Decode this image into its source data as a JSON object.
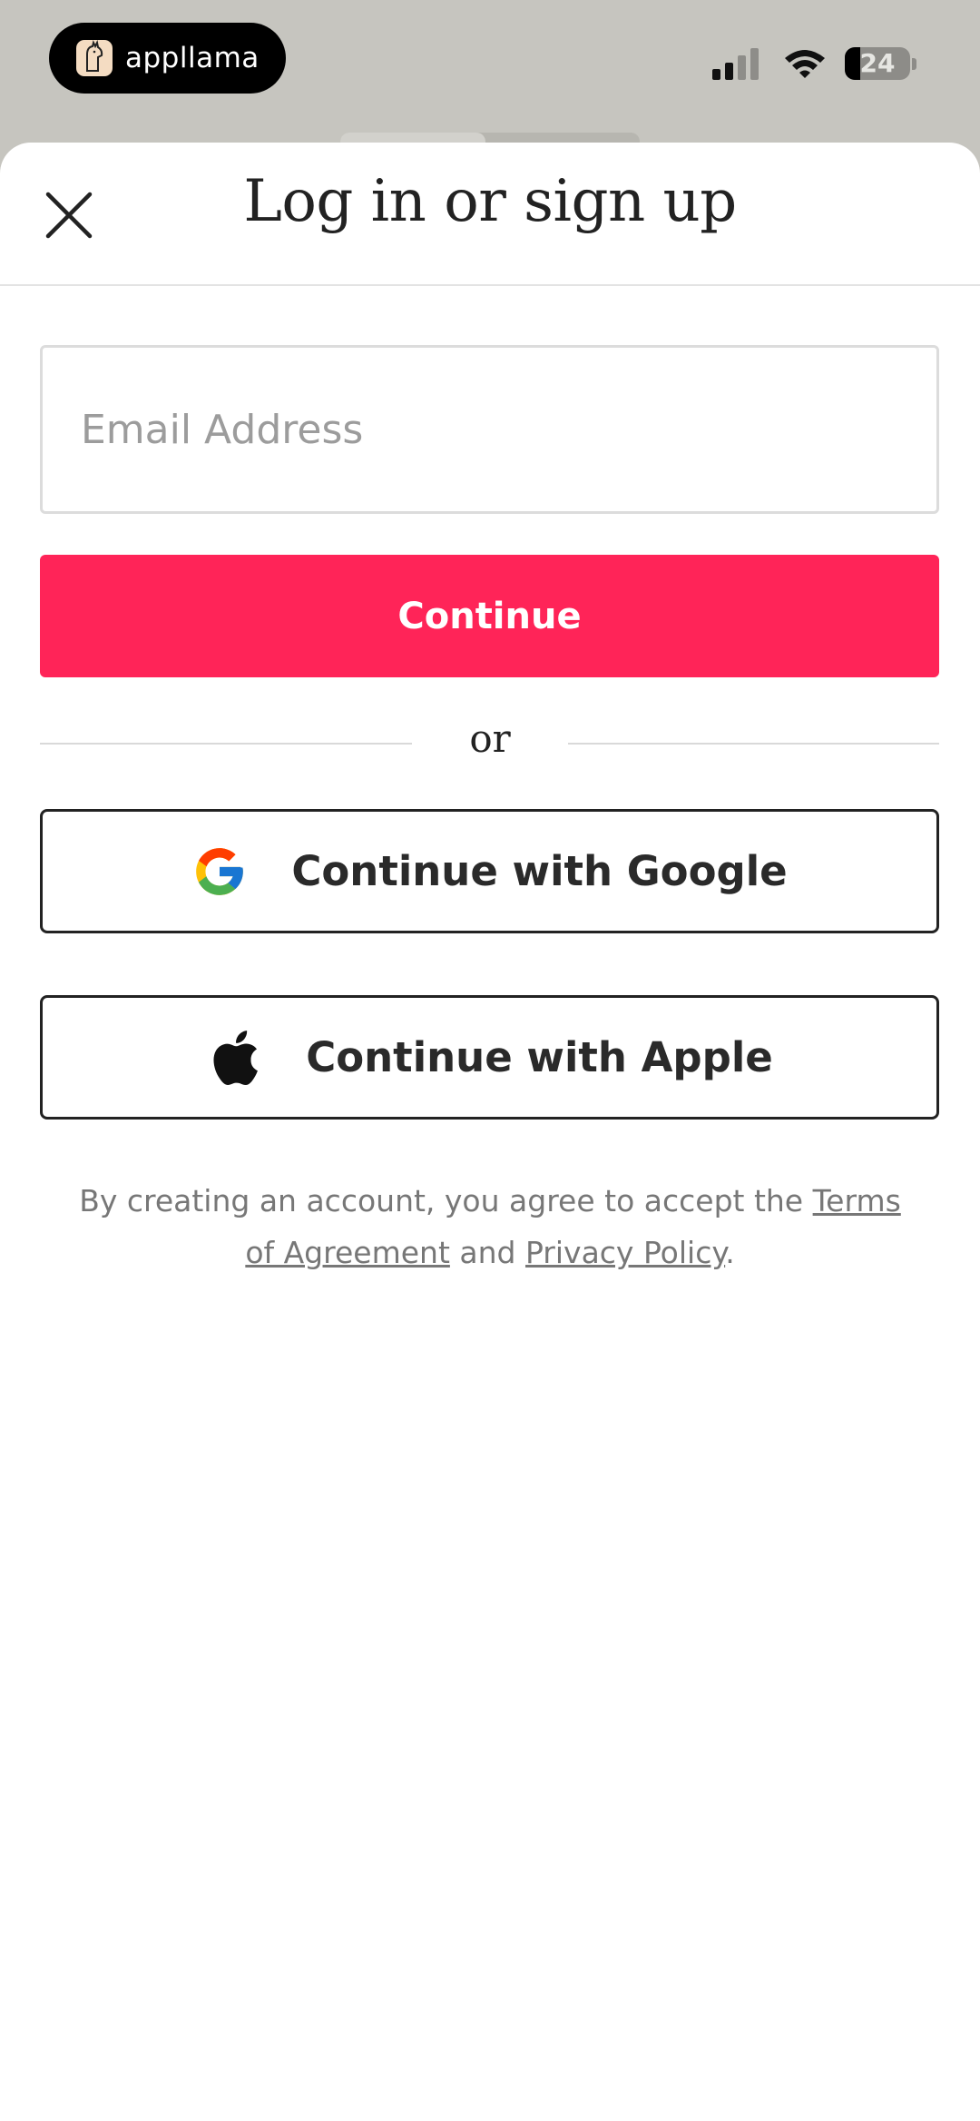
{
  "status_bar": {
    "app_name": "appllama",
    "battery": "24",
    "battery_level": 0.24
  },
  "sheet": {
    "title": "Log in or sign up",
    "email": {
      "placeholder": "Email Address",
      "value": ""
    },
    "continue_label": "Continue",
    "divider_text": "or",
    "google_label": "Continue with Google",
    "apple_label": "Continue with Apple",
    "legal": {
      "prefix": "By creating an account, you agree to accept the",
      "terms": "Terms of Agreement",
      "conjunction": "and",
      "privacy": "Privacy Policy",
      "suffix": "."
    }
  },
  "colors": {
    "accent": "#ff2458",
    "background_dim": "#c6c5bf",
    "text": "#222222"
  },
  "icons": [
    "close-icon",
    "google-icon",
    "apple-icon",
    "signal-icon",
    "wifi-icon",
    "battery-icon",
    "appllama-logo"
  ]
}
